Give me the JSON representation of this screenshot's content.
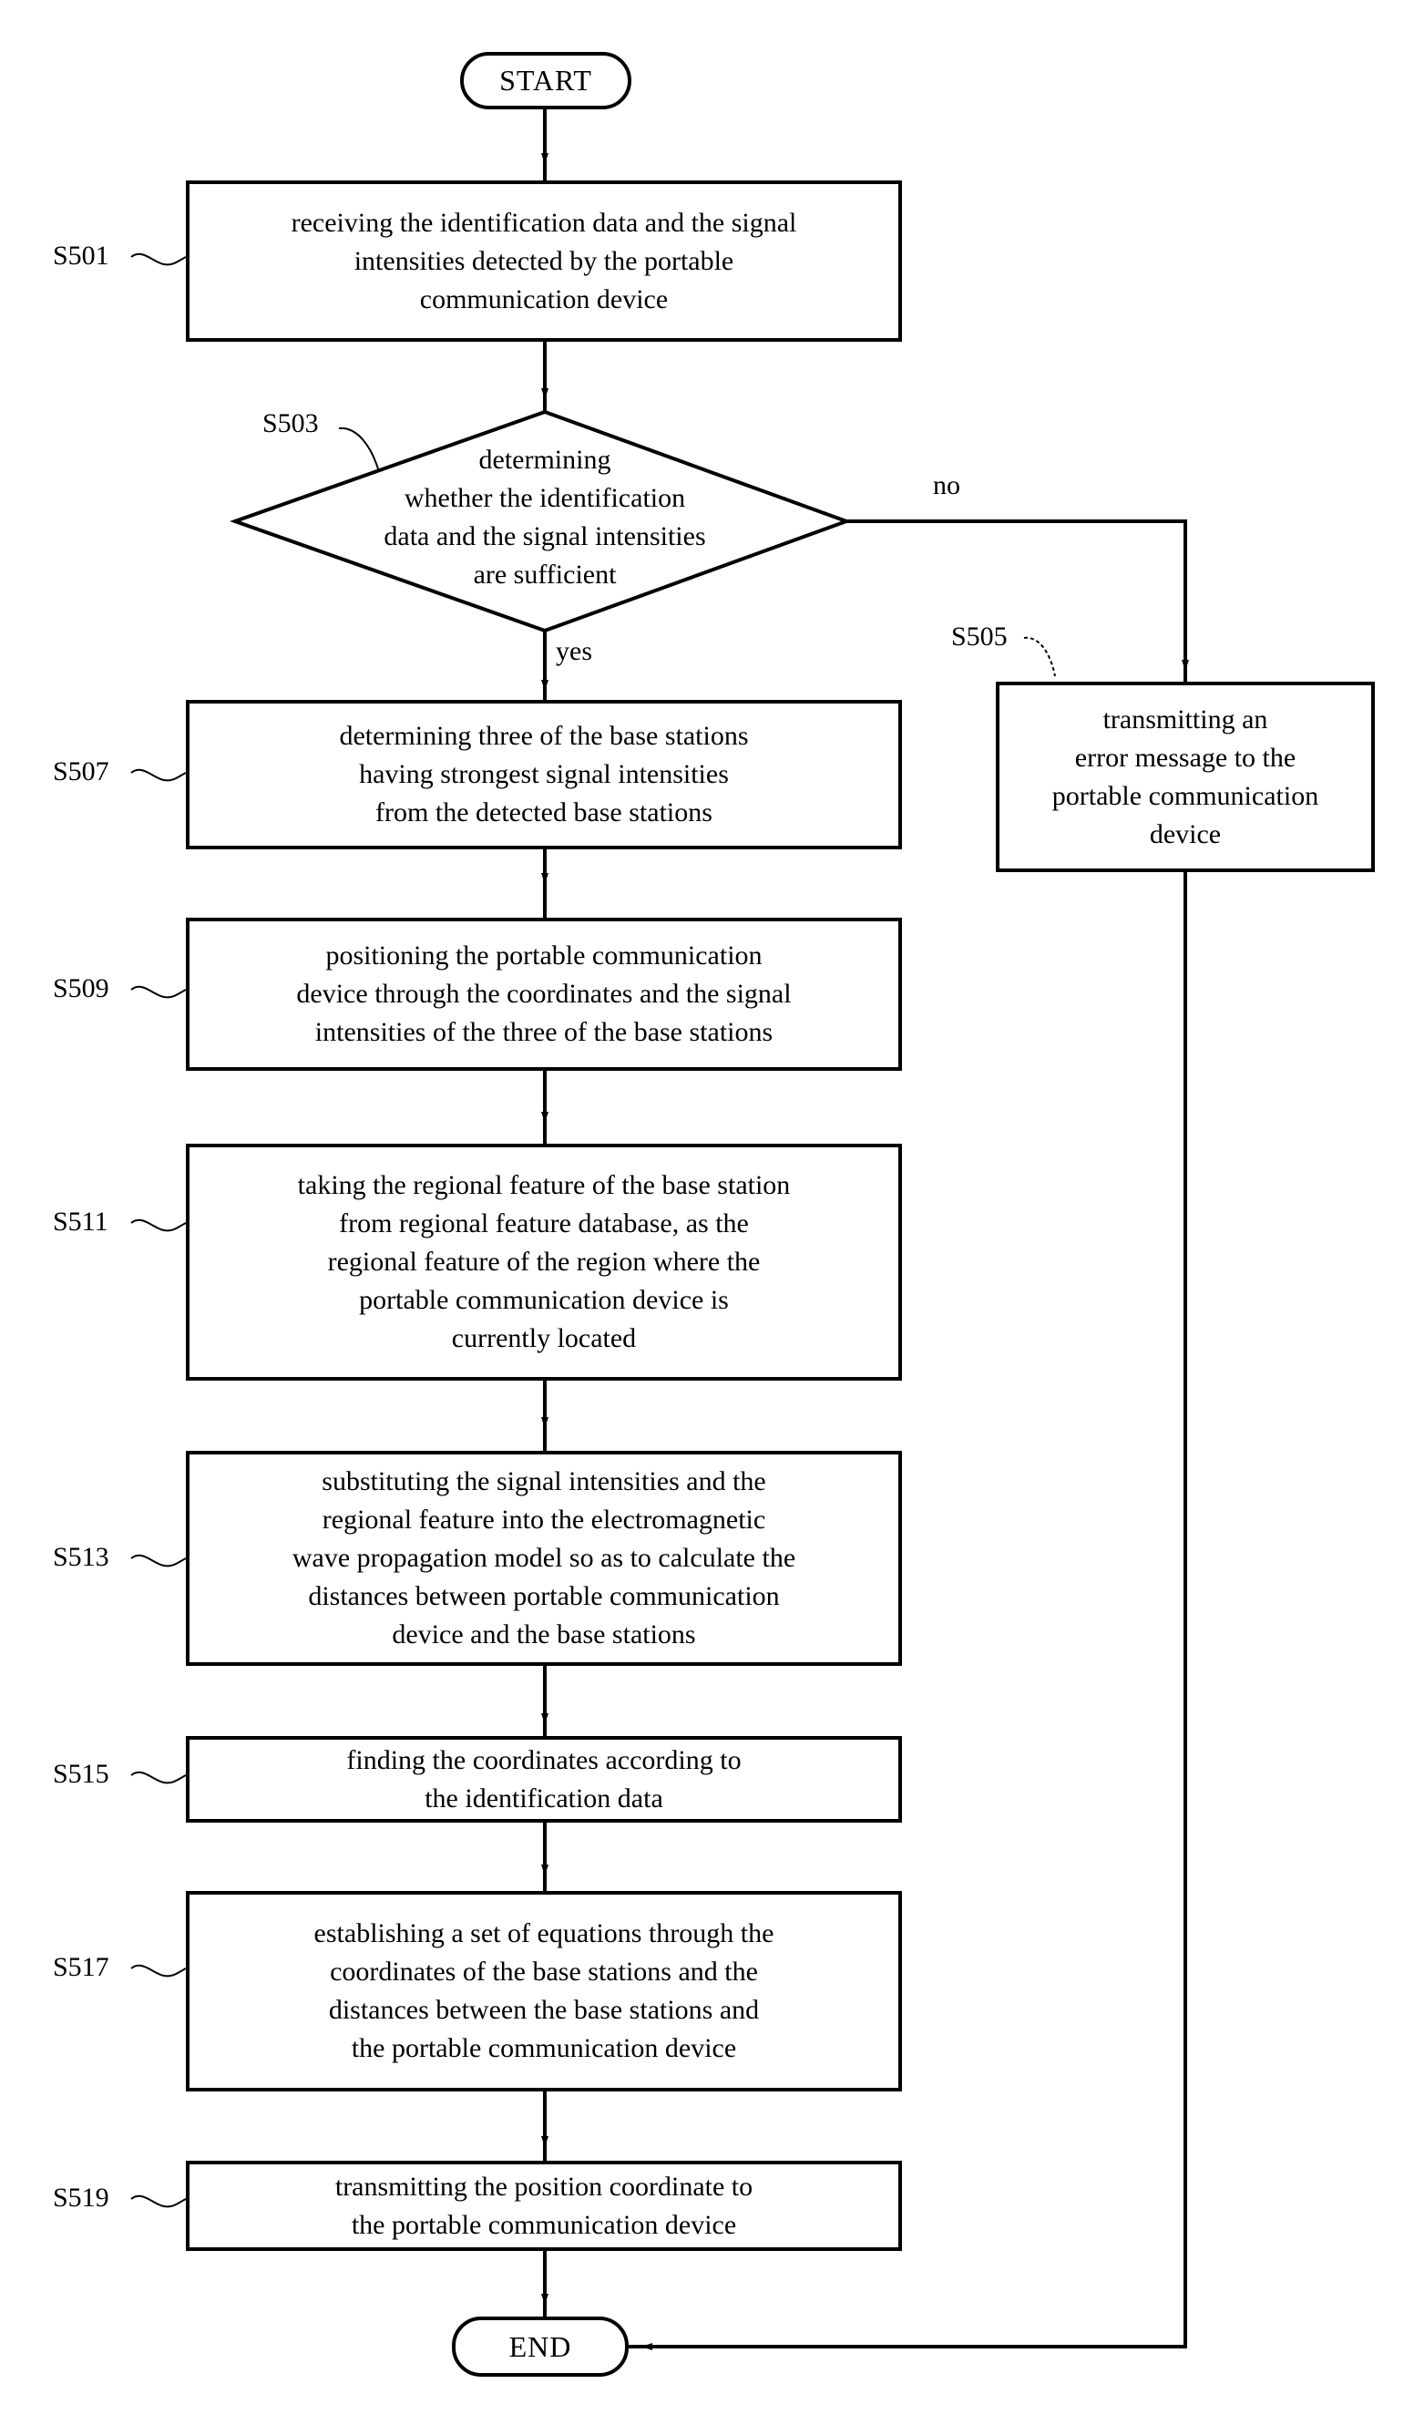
{
  "diagram": {
    "type": "flowchart",
    "start": {
      "label": "START"
    },
    "end": {
      "label": "END"
    },
    "steps": {
      "s501": {
        "id": "S501",
        "text": "receiving the identification data and the signal\nintensities detected by the portable\ncommunication device"
      },
      "s503": {
        "id": "S503",
        "text": "determining\nwhether the identification\ndata and the signal intensities\nare sufficient"
      },
      "s505": {
        "id": "S505",
        "text": "transmitting an\nerror message to the\nportable communication\ndevice"
      },
      "s507": {
        "id": "S507",
        "text": "determining three of the base stations\nhaving strongest signal intensities\nfrom the detected base stations"
      },
      "s509": {
        "id": "S509",
        "text": "positioning the portable communication\ndevice through the coordinates and the signal\nintensities of the three of the base stations"
      },
      "s511": {
        "id": "S511",
        "text": "taking the regional feature of the base station\nfrom regional feature database, as the\nregional feature of the region where the\nportable communication device is\ncurrently located"
      },
      "s513": {
        "id": "S513",
        "text": "substituting the signal intensities and the\nregional feature into the electromagnetic\nwave propagation model so as to calculate the\ndistances between portable communication\ndevice and the base stations"
      },
      "s515": {
        "id": "S515",
        "text": "finding the coordinates according to\nthe identification data"
      },
      "s517": {
        "id": "S517",
        "text": "establishing a set of equations through the\ncoordinates of the base stations and the\ndistances between the base stations and\nthe portable communication device"
      },
      "s519": {
        "id": "S519",
        "text": "transmitting the position coordinate to\nthe portable communication device"
      }
    },
    "branches": {
      "yes": "yes",
      "no": "no"
    },
    "edges": [
      [
        "START",
        "S501"
      ],
      [
        "S501",
        "S503"
      ],
      [
        "S503",
        "S507",
        "yes"
      ],
      [
        "S503",
        "S505",
        "no"
      ],
      [
        "S507",
        "S509"
      ],
      [
        "S509",
        "S511"
      ],
      [
        "S511",
        "S513"
      ],
      [
        "S513",
        "S515"
      ],
      [
        "S515",
        "S517"
      ],
      [
        "S517",
        "S519"
      ],
      [
        "S519",
        "END"
      ],
      [
        "S505",
        "END"
      ]
    ]
  }
}
